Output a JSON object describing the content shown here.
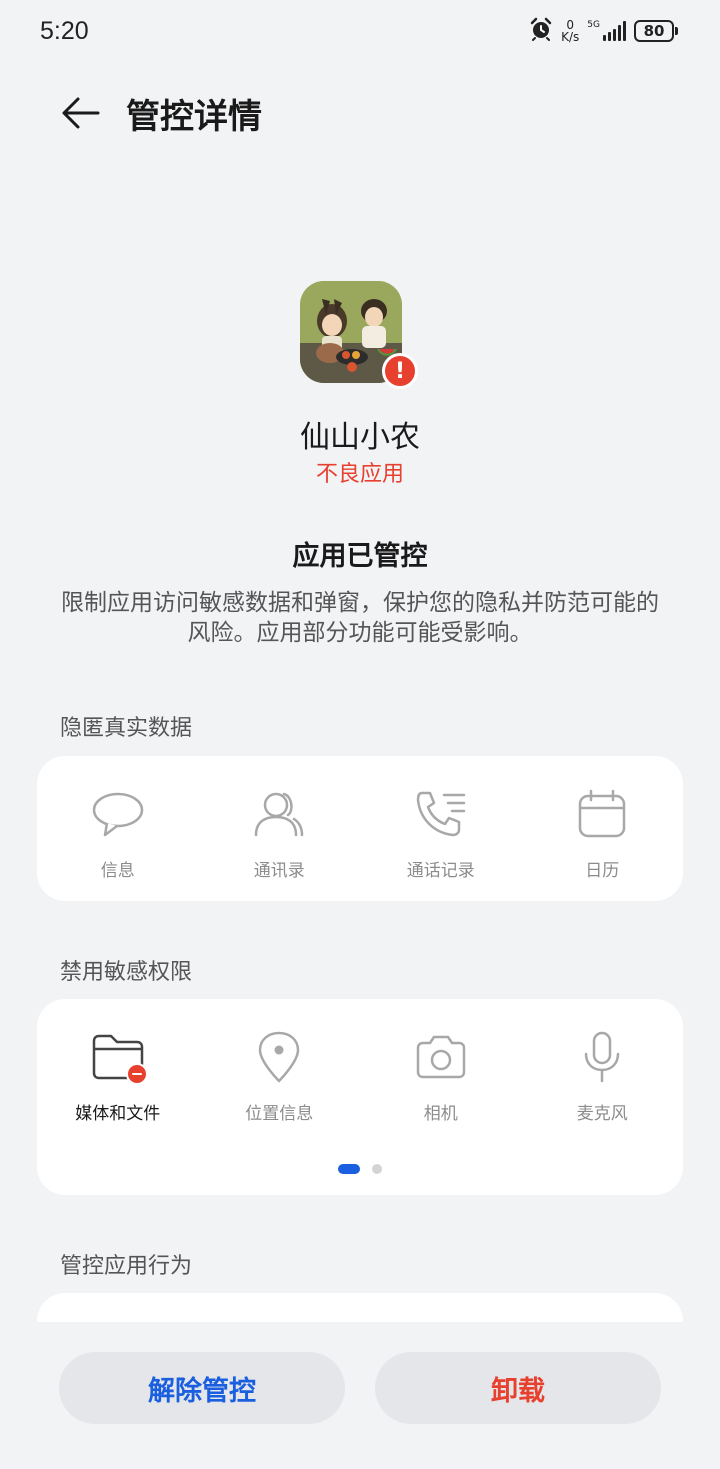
{
  "status_bar": {
    "time": "5:20",
    "net_speed_value": "0",
    "net_speed_unit": "K/s",
    "network_type": "5G",
    "battery": "80"
  },
  "header": {
    "title": "管控详情"
  },
  "app": {
    "name": "仙山小农",
    "tag": "不良应用",
    "warning_icon": "!"
  },
  "control_status": {
    "title": "应用已管控",
    "description": "限制应用访问敏感数据和弹窗，保护您的隐私并防范可能的风险。应用部分功能可能受影响。"
  },
  "hide_data": {
    "label": "隐匿真实数据",
    "items": [
      {
        "label": "信息",
        "icon": "message-icon"
      },
      {
        "label": "通讯录",
        "icon": "contacts-icon"
      },
      {
        "label": "通话记录",
        "icon": "call-log-icon"
      },
      {
        "label": "日历",
        "icon": "calendar-icon"
      }
    ]
  },
  "disable_permissions": {
    "label": "禁用敏感权限",
    "items": [
      {
        "label": "媒体和文件",
        "icon": "folder-icon"
      },
      {
        "label": "位置信息",
        "icon": "location-icon"
      },
      {
        "label": "相机",
        "icon": "camera-icon"
      },
      {
        "label": "麦克风",
        "icon": "microphone-icon"
      }
    ],
    "page_current": 1,
    "page_total": 2
  },
  "control_behavior": {
    "label": "管控应用行为"
  },
  "buttons": {
    "release": "解除管控",
    "uninstall": "卸载"
  },
  "colors": {
    "accent_blue": "#1a5fe0",
    "danger_red": "#e8402e",
    "background": "#f1f3f5"
  }
}
